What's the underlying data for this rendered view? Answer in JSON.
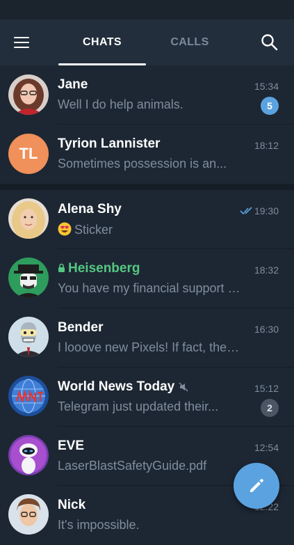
{
  "header": {
    "tabs": [
      {
        "label": "CHATS"
      },
      {
        "label": "CALLS"
      }
    ],
    "active_tab": "CHATS"
  },
  "chats": [
    {
      "name": "Jane",
      "preview": "Well I do help animals.",
      "time": "15:34",
      "unread": "5",
      "avatar_icon": "photo-avatar"
    },
    {
      "name": "Tyrion Lannister",
      "preview": "Sometimes possession is an...",
      "time": "18:12",
      "initials": "TL",
      "avatar_color": "#f0905a"
    },
    {
      "name": "Alena Shy",
      "preview": "Sticker",
      "time": "19:30",
      "emoji_icon": "heart-eyes-emoji",
      "status": "read"
    },
    {
      "name": "Heisenberg",
      "preview": "You have my financial support if...",
      "time": "18:32",
      "secret": true
    },
    {
      "name": "Bender",
      "preview": "I looove new Pixels! If fact, they...",
      "time": "16:30"
    },
    {
      "name": "World News Today",
      "preview": "Telegram just updated their...",
      "time": "15:12",
      "unread": "2",
      "muted": true
    },
    {
      "name": "EVE",
      "preview": "LaserBlastSafetyGuide.pdf",
      "time": "12:54"
    },
    {
      "name": "Nick",
      "preview": "It's impossible.",
      "time": "12:22"
    }
  ],
  "colors": {
    "accent": "#5ba3e0",
    "secret": "#55c782",
    "background": "#1d2733",
    "header": "#232e3c"
  }
}
